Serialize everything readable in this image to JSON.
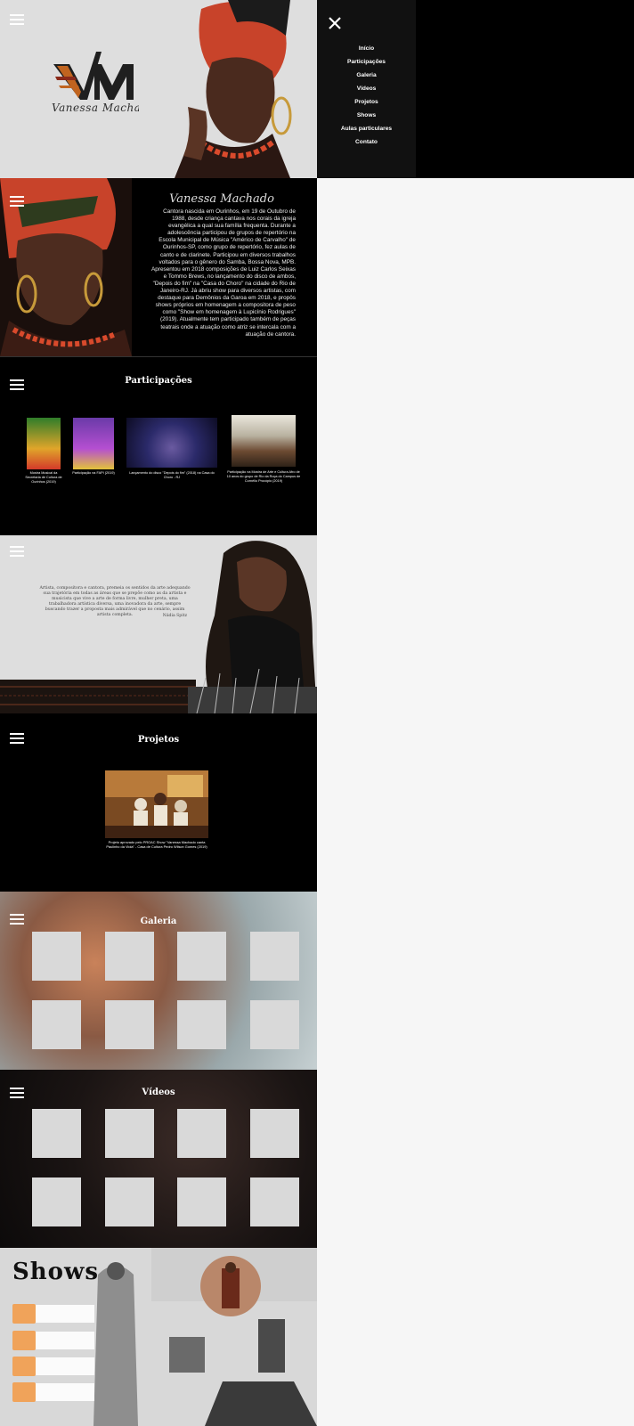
{
  "hero": {
    "logo_initials": "VM",
    "logo_script": "Vanessa Machado"
  },
  "bio": {
    "title": "Vanessa Machado",
    "text": "Cantora nascida em Ourinhos, em 19 de Outubro de 1988, desde criança cantava nos corais da igreja evangélica a qual sua família frequenta. Durante a adolescência participou de grupos de repertório na Escola Municipal de Música \"Américo de Carvalho\" de Ourinhos-SP, como grupo de repertório, fez aulas de canto e de clarinete. Participou em diversos trabalhos voltados para o gênero do Samba, Bossa Nova, MPB. Apresentou em 2018 composições de Luiz Carlos Seixas e Tommo Brews, no lançamento do disco de ambos, \"Depois do fim\" na \"Casa do Choro\" na cidade do Rio de Janeiro-RJ. Já abriu show para diversos artistas, com destaque para Demônios da Garoa em 2018, e propôs shows próprios em homenagem a compositora de peso como \"Show em homenagem à Lupicínio Rodrigues\" (2019). Atualmente tem participado também de peças teatrais onde a atuação como atriz se intercala com a atuação de cantora."
  },
  "participacoes": {
    "title": "Participações",
    "items": [
      {
        "caption": "Mostra Musical da Secretaria de Cultura de Ourinhos (2019)",
        "color": "#2f7d2a"
      },
      {
        "caption": "Participação na FAPI (2019)",
        "color": "#6a3aa8"
      },
      {
        "caption": "Lançamento do disco \"Depois do fim\" (2018) na Casa do Choro - RJ",
        "color": "#2b2a6a"
      },
      {
        "caption": "Participação na Mostra de Arte e Cultura Afro de 10 anos do grupo de Rio da Roça do Campus de Cornélio Procópio (2019)",
        "color": "#6c6a60"
      }
    ]
  },
  "quote": {
    "text": "Artista, compositora e cantora, premeia os sentidos da arte adequando sua trajetória em todas as áreas que se prepõe como as da artista e musicista que vive a arte de forma livre, mulher preta, uma trabalhadora artística diversa, uma inovadora da arte, sempre buscando trazer a proposta mais admirável que no cenário, assim artista completa.",
    "author": "Nádia Spitz"
  },
  "projetos": {
    "title": "Projetos",
    "caption": "Projeto aprovado pelo PROAC Show \"Vanessa Machado canta Paulinho da Viola\" - Casa de Cultura Pedro Wilson Gomes (2019)"
  },
  "galeria": {
    "title": "Galeria"
  },
  "videos": {
    "title": "Vídeos"
  },
  "shows": {
    "title": "Shows"
  },
  "menu": {
    "items": [
      "Início",
      "Participações",
      "Galeria",
      "Vídeos",
      "Projetos",
      "Shows",
      "Aulas particulares",
      "Contato"
    ]
  },
  "colors": {
    "accent_orange": "#f0a35a",
    "dark": "#000000",
    "light_gray": "#dedede"
  }
}
